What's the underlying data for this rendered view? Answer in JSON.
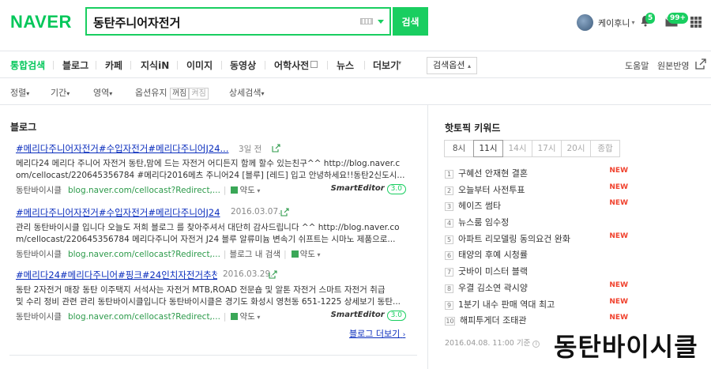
{
  "header": {
    "logo": "NAVER",
    "search_value": "동탄주니어자전거",
    "search_button": "검색",
    "user_name": "케이후니",
    "notif_count": "5",
    "mail_count": "99+"
  },
  "tabs": [
    "통합검색",
    "블로그",
    "카페",
    "지식iN",
    "이미지",
    "동영상",
    "어학사전",
    "뉴스",
    "더보기"
  ],
  "search_options": "검색옵션",
  "right_links": [
    "도움말",
    "원본반영"
  ],
  "filters": {
    "sort": "정렬",
    "period": "기간",
    "area": "영역",
    "option_keep": "옵션유지",
    "keep_on": "꺼짐",
    "keep_off": "켜짐",
    "detail": "상세검색"
  },
  "blog": {
    "section_title": "블로그",
    "results": [
      {
        "title": "#메리다주니어자전거#수입자전거#메리다주니어J24...",
        "date": "3일 전",
        "body1": "메리다24 메리다 주니어 자전거 동탄,맘에 드는 자전거 어디든지 함께 할수 있는친구^^ http://blog.naver.c",
        "body2": "om/cellocast/220645356784 #메리다2016메츠 주니어24 [블루] [레드] 입고 안녕하세요!!동탄2신도시...",
        "source": "동탄바이시클",
        "url": "blog.naver.com/cellocast?Redirect,...",
        "extra": "",
        "map_label": "약도"
      },
      {
        "title": "#메리다주니어자전거#수입자전거#메리다주니어J24",
        "date": "2016.03.07.",
        "body1": "관리 동탄바이시클 입니다 오늘도 저희 블로그 를 찾아주셔서 대단히 감사드립니다 ^^ http://blog.naver.co",
        "body2": "m/cellocast/220645356784 메리다주니어 자전거 J24 블루 알류미늄 변속기 쉬프트는 시마노 제품으로...",
        "source": "동탄바이시클",
        "url": "blog.naver.com/cellocast?Redirect,...",
        "extra": "블로그 내 검색",
        "map_label": "약도"
      },
      {
        "title": "#메리다24#메리다주니어#핑크#24인치자전거추천",
        "date": "2016.03.29.",
        "body1": "동탄 2자전거 매장 동탄 이주택지 서석사는 자전거 MTB,ROAD 전문숍 및 알톤 자전거 스마트 자전거 취급",
        "body2": "및 수리 정비 관련 관리 동탄바이시클입니다 동탄바이시클은 경기도 화성시 영천동 651-1225 상세보기 동탄...",
        "source": "동탄바이시클",
        "url": "blog.naver.com/cellocast?Redirect,...",
        "extra": "",
        "map_label": "약도"
      }
    ],
    "smart_editor": "SmartEditor",
    "smart_editor_ver": "3.0",
    "more": "블로그 더보기"
  },
  "hot": {
    "section_title": "핫토픽 키워드",
    "times": [
      "8시",
      "11시",
      "14시",
      "17시",
      "20시",
      "종합"
    ],
    "keywords": [
      {
        "rank": "1",
        "text": "구혜선 안재현 결혼",
        "new": "NEW"
      },
      {
        "rank": "2",
        "text": "오늘부터 사전투표",
        "new": "NEW"
      },
      {
        "rank": "3",
        "text": "헤이즈 썸타",
        "new": "NEW"
      },
      {
        "rank": "4",
        "text": "뉴스룸 임수정",
        "new": ""
      },
      {
        "rank": "5",
        "text": "아파트 리모델링 동의요건 완화",
        "new": "NEW"
      },
      {
        "rank": "6",
        "text": "태양의 후예 시청률",
        "new": ""
      },
      {
        "rank": "7",
        "text": "굿바이 미스터 블랙",
        "new": ""
      },
      {
        "rank": "8",
        "text": "우결 김소연 곽시양",
        "new": "NEW"
      },
      {
        "rank": "9",
        "text": "1분기 내수 판매 역대 최고",
        "new": "NEW"
      },
      {
        "rank": "10",
        "text": "해피투게더 조태관",
        "new": "NEW"
      }
    ],
    "timestamp": "2016.04.08. 11:00 기준"
  },
  "watermark": "동탄바이시클",
  "colors": {
    "brand": "#03c75a",
    "link": "#0a2dbd",
    "url": "#2c9a4a",
    "new": "#f0412d"
  }
}
